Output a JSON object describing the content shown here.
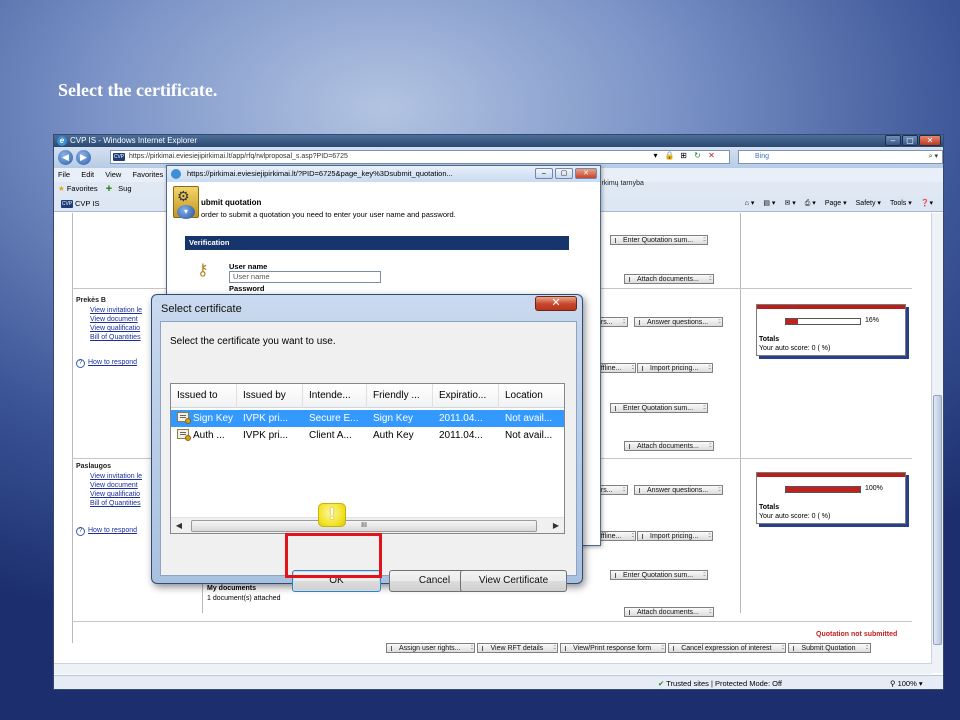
{
  "slide": {
    "caption": "Select the certificate."
  },
  "ie": {
    "title": "CVP IS - Windows Internet Explorer",
    "address": "https://pirkimai.eviesiejipirkimai.lt/app/rfq/rwlproposal_s.asp?PID=6725",
    "address_badge": "CVP",
    "search_placeholder": "Bing",
    "menu": [
      "File",
      "Edit",
      "View",
      "Favorites"
    ],
    "favorites_label": "Favorites",
    "suggested_label": "Sug",
    "tab_label": "CVP IS",
    "tab_badge": "CVP",
    "commands": [
      "Page ▾",
      "Safety ▾",
      "Tools ▾",
      "❓▾"
    ],
    "org_text": "pirkimų tarnyba",
    "status": {
      "trusted": "Trusted sites | Protected Mode: Off",
      "zoom": "100%"
    }
  },
  "background_page": {
    "sections": [
      {
        "title": "Prekės B",
        "links": [
          "View invitation le",
          "View document",
          "View qualificatio",
          "Bill of Quantities"
        ],
        "how_to": "How to respond",
        "score": {
          "percent_label": "16%",
          "fill": 0.16,
          "totals": "Totals",
          "auto_score": "Your auto score: 0 (  %)"
        }
      },
      {
        "title": "Paslaugos",
        "links": [
          "View invitation le",
          "View document",
          "View qualificatio",
          "Bill of Quantities"
        ],
        "how_to": "How to respond",
        "score": {
          "percent_label": "100%",
          "fill": 1.0,
          "totals": "Totals",
          "auto_score": "Your auto score: 0 (  %)"
        }
      }
    ],
    "buttons": {
      "enter_quotation": "Enter Quotation sum...",
      "attach_documents": "Attach documents...",
      "answer_questions": "Answer questions...",
      "offline": "offline...",
      "import_pricing": "Import pricing...",
      "ers": "ers..."
    },
    "my_documents": {
      "title": "My documents",
      "count": "1 document(s) attached"
    },
    "not_submitted": "Quotation not submitted",
    "bottom_actions": [
      "Assign user rights...",
      "View RFT details",
      "View/Print response form",
      "Cancel expression of interest",
      "Submit Quotation"
    ]
  },
  "quote_window": {
    "title": "https://pirkimai.eviesiejipirkimai.lt/?PID=6725&page_key%3Dsubmit_quotation...",
    "heading": "ubmit quotation",
    "instruction": "order to submit a quotation you need to enter your user name and password.",
    "verification": "Verification",
    "username_label": "User name",
    "username_value": "User name",
    "password_label": "Password"
  },
  "cert_dialog": {
    "title": "Select certificate",
    "close": "✕",
    "prompt": "Select the certificate you want to use.",
    "columns": [
      "Issued to",
      "Issued by",
      "Intende...",
      "Friendly ...",
      "Expiratio...",
      "Location"
    ],
    "rows": [
      [
        "Sign Key",
        "IVPK pri...",
        "Secure E...",
        "Sign Key",
        "2011.04...",
        "Not avail..."
      ],
      [
        "Auth ...",
        "IVPK pri...",
        "Client A...",
        "Auth Key",
        "2011.04...",
        "Not avail..."
      ]
    ],
    "scroll_grip": "III",
    "buttons": {
      "ok": "OK",
      "cancel": "Cancel",
      "view": "View Certificate"
    }
  },
  "annotation": {
    "marker": "!",
    "marker_color": "#f3e42a",
    "highlight_color": "#e4121a"
  }
}
